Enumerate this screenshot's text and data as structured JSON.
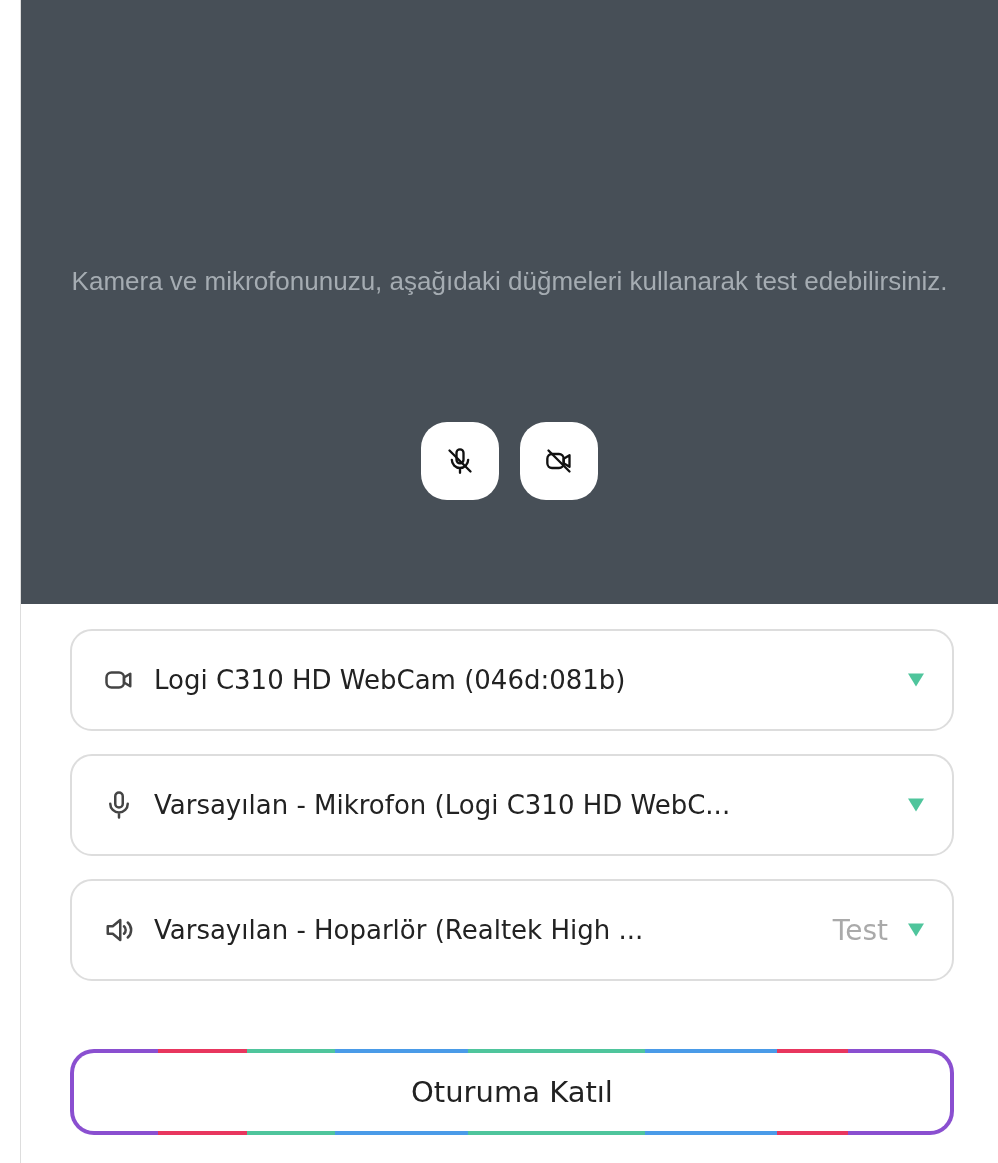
{
  "preview": {
    "message": "Kamera ve mikrofonunuzu, aşağıdaki düğmeleri kullanarak test edebilirsiniz.",
    "toggles": [
      {
        "kind": "microphone",
        "muted": true
      },
      {
        "kind": "camera",
        "muted": true
      }
    ]
  },
  "devices": [
    {
      "kind": "camera",
      "value": "Logi C310 HD WebCam (046d:081b)"
    },
    {
      "kind": "microphone",
      "value": "Varsayılan - Mikrofon (Logi C310 HD WebC..."
    },
    {
      "kind": "speaker",
      "value": "Varsayılan - Hoparlör (Realtek High ...",
      "test": "Test"
    }
  ],
  "join_button": "Oturuma Katıl"
}
